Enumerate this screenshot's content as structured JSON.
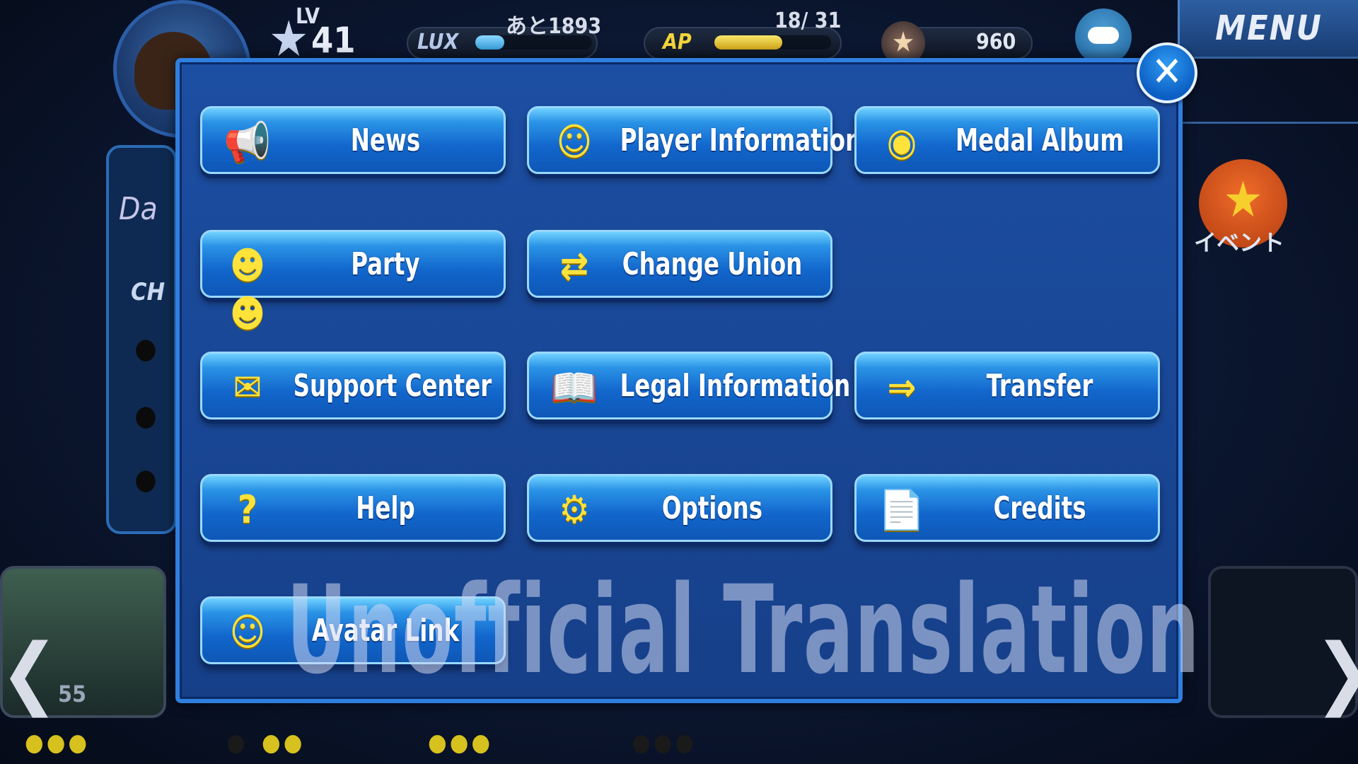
{
  "hud": {
    "level_label": "LV",
    "level_value": "41",
    "lux_label": "LUX",
    "lux_remaining": "あと1893",
    "lux_progress": 0.25,
    "ap_label": "AP",
    "ap_count": "18/ 31",
    "ap_progress": 0.58,
    "jewel_count": "960",
    "menu_label": "MENU",
    "event_label": "イベント"
  },
  "background": {
    "left_tab_label": "CH",
    "card_count": "55"
  },
  "modal": {
    "close_glyph": "✕",
    "items": [
      {
        "label": "News",
        "icon": "megaphone-icon",
        "glyph": "📢"
      },
      {
        "label": "Player Information",
        "icon": "smiley-icon",
        "glyph": "☺"
      },
      {
        "label": "Medal Album",
        "icon": "medal-icon",
        "glyph": "◉"
      },
      {
        "label": "Party",
        "icon": "party-icon",
        "glyph": "☻☻"
      },
      {
        "label": "Change Union",
        "icon": "union-swap-icon",
        "glyph": "⇄"
      },
      {
        "label": "Support Center",
        "icon": "envelope-icon",
        "glyph": "✉"
      },
      {
        "label": "Legal Information",
        "icon": "book-icon",
        "glyph": "📖"
      },
      {
        "label": "Transfer",
        "icon": "transfer-icon",
        "glyph": "⇒"
      },
      {
        "label": "Help",
        "icon": "question-icon",
        "glyph": "?"
      },
      {
        "label": "Options",
        "icon": "gear-icon",
        "glyph": "⚙"
      },
      {
        "label": "Credits",
        "icon": "document-icon",
        "glyph": "📄"
      },
      {
        "label": "Avatar Link",
        "icon": "avatar-link-icon",
        "glyph": "☺"
      }
    ]
  },
  "watermark": "Unofficial Translation",
  "colors": {
    "modal_bg": "#1a4898",
    "button_blue": "#1266cc",
    "icon_yellow": "#ffe23a"
  }
}
